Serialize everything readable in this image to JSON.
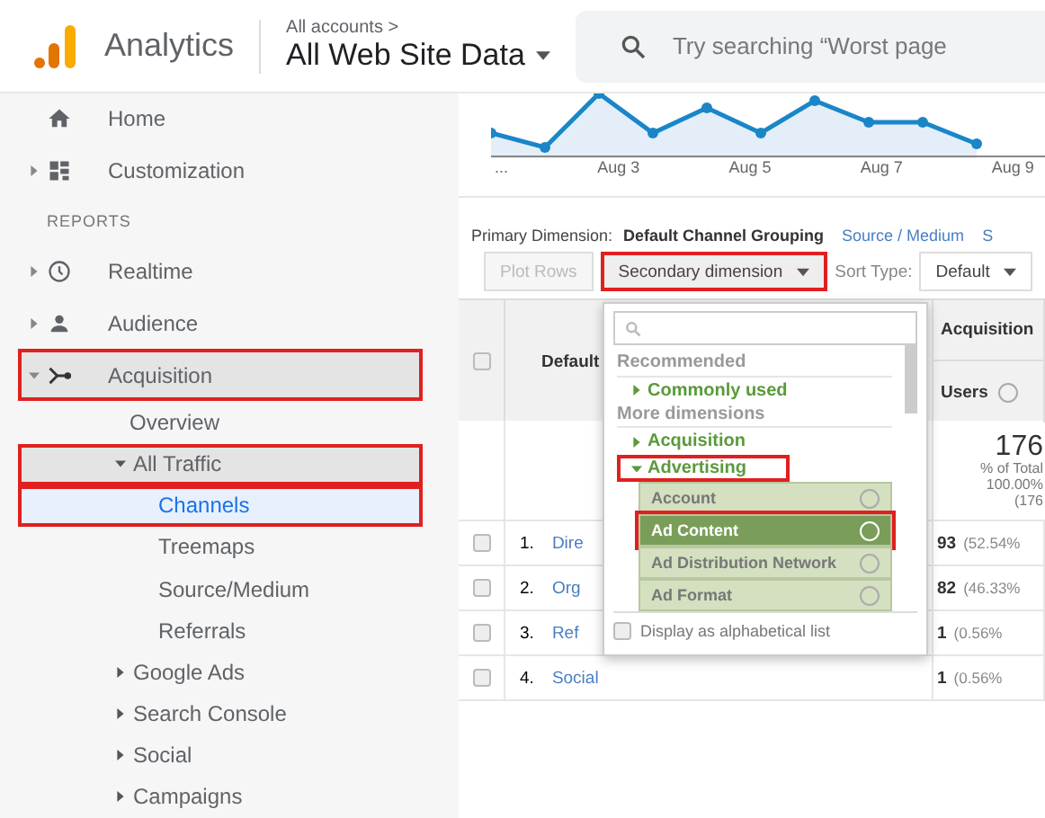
{
  "header": {
    "product": "Analytics",
    "breadcrumb": "All accounts >",
    "property": "All Web Site Data",
    "search": {
      "placeholder": "Try searching “Worst page"
    }
  },
  "sidebar": {
    "items": [
      {
        "kind": "item",
        "label": "Home",
        "selected": false,
        "highlighted": false
      },
      {
        "kind": "item",
        "label": "Customization",
        "expanded": false,
        "selected": false,
        "highlighted": false
      },
      {
        "kind": "section",
        "label": "REPORTS"
      },
      {
        "kind": "item",
        "label": "Realtime",
        "expanded": false,
        "selected": false,
        "highlighted": false
      },
      {
        "kind": "item",
        "label": "Audience",
        "expanded": false,
        "selected": false,
        "highlighted": false
      },
      {
        "kind": "item",
        "label": "Acquisition",
        "expanded": true,
        "selected": false,
        "highlighted": true,
        "children": [
          {
            "kind": "item",
            "label": "Overview",
            "selected": false,
            "highlighted": false
          },
          {
            "kind": "item",
            "label": "All Traffic",
            "expanded": true,
            "selected": false,
            "highlighted": true,
            "children": [
              {
                "kind": "item",
                "label": "Channels",
                "selected": true,
                "highlighted": true
              },
              {
                "kind": "item",
                "label": "Treemaps",
                "selected": false,
                "highlighted": false
              },
              {
                "kind": "item",
                "label": "Source/Medium",
                "selected": false,
                "highlighted": false
              },
              {
                "kind": "item",
                "label": "Referrals",
                "selected": false,
                "highlighted": false
              }
            ]
          },
          {
            "kind": "item",
            "label": "Google Ads",
            "expanded": false,
            "selected": false,
            "highlighted": false
          },
          {
            "kind": "item",
            "label": "Search Console",
            "expanded": false,
            "selected": false,
            "highlighted": false
          },
          {
            "kind": "item",
            "label": "Social",
            "expanded": false,
            "selected": false,
            "highlighted": false
          },
          {
            "kind": "item",
            "label": "Campaigns",
            "expanded": false,
            "selected": false,
            "highlighted": false
          }
        ]
      }
    ]
  },
  "chart": {
    "x_labels": [
      "...",
      "Aug 3",
      "Aug 5",
      "Aug 7",
      "Aug 9"
    ]
  },
  "dimension_bar": {
    "label": "Primary Dimension:",
    "current": "Default Channel Grouping",
    "links": [
      "Source / Medium",
      "S"
    ]
  },
  "toolbar": {
    "plot_rows": {
      "label": "Plot Rows",
      "disabled": true
    },
    "secondary": {
      "label": "Secondary dimension",
      "highlighted": true
    },
    "sort_label": "Sort Type:",
    "sort_value": "Default"
  },
  "table": {
    "all_checked": false,
    "columns": [
      "Default",
      "Acquisition",
      "Users"
    ],
    "totals": {
      "value": "176",
      "label": "% of Total",
      "percent": "100.00%",
      "base": "(176"
    },
    "rows": [
      {
        "index": "1.",
        "name": "Dire",
        "users": "93",
        "share": "(52.54%",
        "checked": false
      },
      {
        "index": "2.",
        "name": "Org",
        "users": "82",
        "share": "(46.33%",
        "checked": false
      },
      {
        "index": "3.",
        "name": "Ref",
        "users": "1",
        "share": "(0.56%",
        "checked": false
      },
      {
        "index": "4.",
        "name": "Social",
        "users": "1",
        "share": "(0.56%",
        "checked": false
      }
    ]
  },
  "dropdown": {
    "groups": [
      {
        "title": "Recommended",
        "items": [
          {
            "label": "Commonly used",
            "expanded": false,
            "highlighted": false
          }
        ]
      },
      {
        "title": "More dimensions",
        "items": [
          {
            "label": "Acquisition",
            "expanded": false,
            "highlighted": false
          },
          {
            "label": "Advertising",
            "expanded": true,
            "highlighted": true,
            "options": [
              {
                "label": "Account",
                "selected": false,
                "highlighted": false
              },
              {
                "label": "Ad Content",
                "selected": true,
                "highlighted": true
              },
              {
                "label": "Ad Distribution Network",
                "selected": false,
                "highlighted": false
              },
              {
                "label": "Ad Format",
                "selected": false,
                "highlighted": false
              }
            ]
          }
        ]
      }
    ],
    "alphabetical": {
      "label": "Display as alphabetical list",
      "checked": false
    }
  }
}
